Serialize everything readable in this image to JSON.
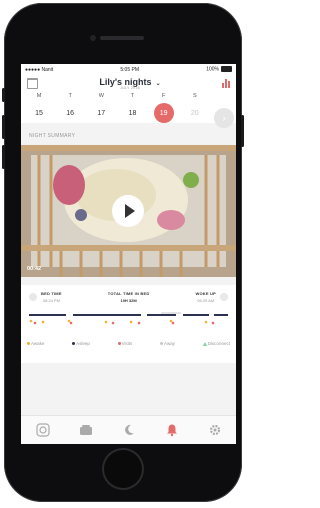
{
  "status": {
    "carrier": "●●●●● Nanit",
    "time": "5:05 PM",
    "battery": "100%"
  },
  "header": {
    "title": "Lily's nights",
    "date": "JULY 2016"
  },
  "week": {
    "days": [
      {
        "letter": "M",
        "num": "15"
      },
      {
        "letter": "T",
        "num": "16"
      },
      {
        "letter": "W",
        "num": "17"
      },
      {
        "letter": "T",
        "num": "18"
      },
      {
        "letter": "F",
        "num": "19"
      },
      {
        "letter": "S",
        "num": "20"
      }
    ],
    "selected": "19"
  },
  "summary": {
    "section_label": "NIGHT SUMMARY",
    "video_time": "00:42"
  },
  "stats": {
    "bed_time_label": "BED TIME",
    "bed_time": "08:24 PM",
    "total_label": "TOTAL TIME IN BED",
    "total": "10H 32M",
    "woke_label": "WOKE UP",
    "woke": "06:29 AM"
  },
  "legend": {
    "awake": "Awake",
    "asleep": "Asleep",
    "visits": "Visits",
    "away": "Away",
    "disconnect": "Disconnect"
  },
  "colors": {
    "accent": "#e56b6b",
    "asleep": "#2d3150",
    "awake": "#f0b33a",
    "away": "#c8c8cc",
    "disconnect": "#7fcf9f"
  }
}
